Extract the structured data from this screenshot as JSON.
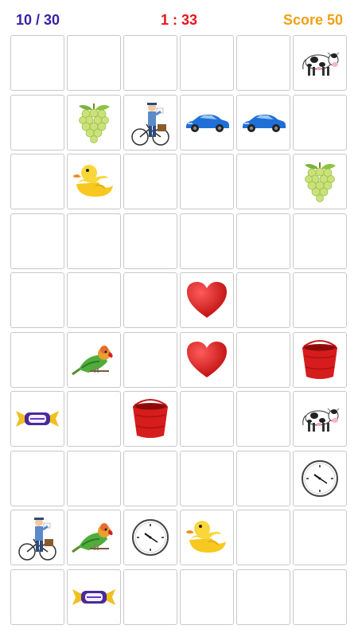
{
  "header": {
    "progress": "10 / 30",
    "timer": "1 : 33",
    "score": "Score 50",
    "colors": {
      "progress": "#3a20a8",
      "timer": "#e8141c",
      "score": "#f0a014"
    }
  },
  "board": {
    "rows": 10,
    "cols": 6,
    "cells": [
      [
        "",
        "",
        "",
        "",
        "",
        "cow"
      ],
      [
        "",
        "grapes",
        "postman",
        "car",
        "car",
        ""
      ],
      [
        "",
        "duck",
        "",
        "",
        "",
        "grapes"
      ],
      [
        "",
        "",
        "",
        "",
        "",
        ""
      ],
      [
        "",
        "",
        "",
        "heart",
        "",
        ""
      ],
      [
        "",
        "parrot",
        "",
        "heart",
        "",
        "bucket"
      ],
      [
        "candy",
        "",
        "bucket",
        "",
        "",
        "cow"
      ],
      [
        "",
        "",
        "",
        "",
        "",
        "clock"
      ],
      [
        "postman",
        "parrot",
        "clock",
        "duck",
        "",
        ""
      ],
      [
        "",
        "candy",
        "",
        "",
        "",
        ""
      ]
    ]
  }
}
